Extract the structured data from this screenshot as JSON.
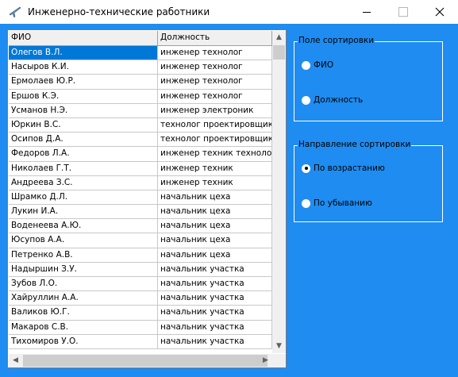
{
  "window": {
    "title": "Инженерно-технические работники"
  },
  "grid": {
    "columns": [
      "ФИО",
      "Должность"
    ],
    "rows": [
      [
        "Олегов В.Л.",
        "инженер технолог"
      ],
      [
        "Насыров К.И.",
        "инженер технолог"
      ],
      [
        "Ермолаев Ю.Р.",
        "инженер технолог"
      ],
      [
        "Ершов К.Э.",
        "инженер технолог"
      ],
      [
        "Усманов Н.Э.",
        "инженер электроник"
      ],
      [
        "Юркин В.С.",
        "технолог проектировщик"
      ],
      [
        "Осипов Д.А.",
        "технолог проектировщик"
      ],
      [
        "Федоров Л.А.",
        "инженер техник технолог"
      ],
      [
        "Николаев Г.Т.",
        "инженер техник"
      ],
      [
        "Андреева З.С.",
        "инженер техник"
      ],
      [
        "Шрамко Д.Л.",
        "начальник цеха"
      ],
      [
        "Лукин И.А.",
        "начальник цеха"
      ],
      [
        "Воденеева А.Ю.",
        "начальник цеха"
      ],
      [
        "Юсупов А.А.",
        "начальник цеха"
      ],
      [
        "Петренко А.В.",
        "начальник цеха"
      ],
      [
        "Надыршин З.У.",
        "начальник участка"
      ],
      [
        "Зубов Л.О.",
        "начальник участка"
      ],
      [
        "Хайруллин А.А.",
        "начальник участка"
      ],
      [
        "Валиков Ю.Г.",
        "начальник участка"
      ],
      [
        "Макаров С.В.",
        "начальник участка"
      ],
      [
        "Тихомиров У.О.",
        "начальник участка"
      ]
    ],
    "selected_row": 0
  },
  "sort_field": {
    "legend": "Поле сортировки",
    "options": [
      {
        "label": "ФИО",
        "checked": false
      },
      {
        "label": "Должность",
        "checked": false
      }
    ]
  },
  "sort_direction": {
    "legend": "Направление сортировки",
    "options": [
      {
        "label": "По возрастанию",
        "checked": true
      },
      {
        "label": "По убыванию",
        "checked": false
      }
    ]
  },
  "icons": {
    "app": "airplane-icon",
    "minimize": "minimize-icon",
    "maximize": "maximize-icon",
    "close": "close-icon"
  },
  "colors": {
    "client_background": "#1e8cf0",
    "selection": "#0078d7"
  }
}
